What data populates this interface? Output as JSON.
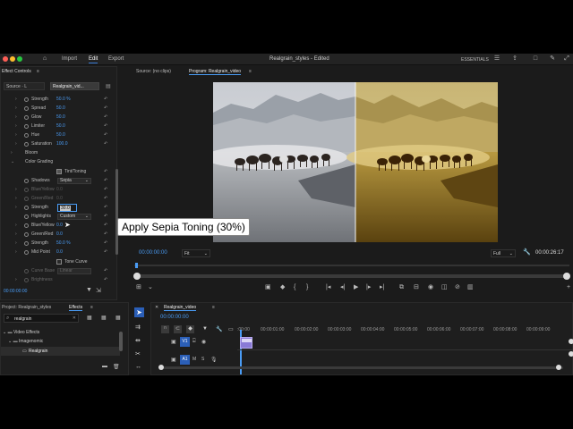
{
  "titlebar": {
    "nav": [
      "Import",
      "Edit",
      "Export"
    ],
    "active": "Edit",
    "document_title": "Realgrain_styles - Edited",
    "workspace": "ESSENTIALS"
  },
  "effect_controls": {
    "panel_title": "Effect Controls",
    "source_tab": "Source · L",
    "clip_tab": "Realgrain_vid...",
    "rows": [
      {
        "label": "Strength",
        "value": "50.0 %"
      },
      {
        "label": "Spread",
        "value": "50.0"
      },
      {
        "label": "Glow",
        "value": "50.0"
      },
      {
        "label": "Limiter",
        "value": "50.0"
      },
      {
        "label": "Hue",
        "value": "50.0"
      },
      {
        "label": "Saturation",
        "value": "100.0"
      }
    ],
    "bloom_label": "Bloom",
    "color_grading_label": "Color Grading",
    "tint_toning_label": "Tint/Toning",
    "shadows_label": "Shadows",
    "shadows_value": "Sepia",
    "blue_yellow_1": "Blue/Yellow",
    "blue_yellow_1_value": "0.0",
    "green_red_1": "Green/Red",
    "green_red_1_value": "0.0",
    "strength_2_label": "Strength",
    "strength_2_value": "30.0",
    "highlights_label": "Highlights",
    "highlights_value": "Custom",
    "blue_yellow_2": "Blue/Yellow",
    "blue_yellow_2_value": "0.0",
    "green_red_2": "Green/Red",
    "green_red_2_value": "0.0",
    "strength_3_label": "Strength",
    "strength_3_value": "50.0 %",
    "midpoint_label": "Mid Point",
    "midpoint_value": "0.0",
    "tone_curve_label": "Tone Curve",
    "curve_base_label": "Curve Base",
    "curve_base_value": "Linear",
    "brightness_label": "Brightness",
    "timecode": "00:00:00:00"
  },
  "program": {
    "source_tab": "Source: (no clips)",
    "program_tab": "Program: Realgrain_video",
    "timecode_left": "00:00:00:00",
    "fit_value": "Fit",
    "quality_value": "Full",
    "timecode_right": "00:00:26:17"
  },
  "tooltip": "Apply Sepia Toning (30%)",
  "project": {
    "project_tab": "Project: Realgrain_styles",
    "effects_tab": "Effects",
    "search_value": "realgrain",
    "tree": [
      "Video Effects",
      "Imagenomic",
      "Realgrain"
    ]
  },
  "timeline": {
    "sequence_tab": "Realgrain_video",
    "timecode": "00:00:00:00",
    "ruler": [
      ":00:00",
      "00:00:01:00",
      "00:00:02:00",
      "00:00:03:00",
      "00:00:04:00",
      "00:00:05:00",
      "00:00:06:00",
      "00:00:07:00",
      "00:00:08:00",
      "00:00:09:00"
    ],
    "video_track": "V1",
    "audio_track": "A1",
    "audio_m": "M",
    "audio_s": "S"
  },
  "colors": {
    "accent": "#4a9cf5",
    "panel_bg": "#1e1e1e",
    "track_blue": "#2b5fb8",
    "clip_purple": "#8a7ad6"
  }
}
